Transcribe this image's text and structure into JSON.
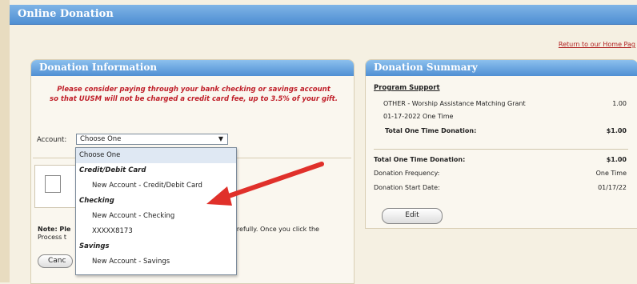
{
  "header": {
    "title": "Online Donation"
  },
  "home_link": "Return to our Home Pag",
  "donation_info": {
    "title": "Donation Information",
    "notice_line1": "Please consider paying through your bank checking or savings account",
    "notice_line2": "so that UUSM will not be charged a credit card fee, up to 3.5% of your gift.",
    "account_label": "Account:",
    "account_selected": "Choose One",
    "dropdown_options": [
      {
        "label": "Choose One",
        "type": "option",
        "selected": true
      },
      {
        "label": "Credit/Debit Card",
        "type": "group"
      },
      {
        "label": "New Account - Credit/Debit Card",
        "type": "option"
      },
      {
        "label": "Checking",
        "type": "group"
      },
      {
        "label": "New Account - Checking",
        "type": "option"
      },
      {
        "label": "XXXXX8173",
        "type": "option"
      },
      {
        "label": "Savings",
        "type": "group"
      },
      {
        "label": "New Account - Savings",
        "type": "option"
      }
    ],
    "note_left": "Note: Ple",
    "note_left2": "Process t",
    "note_right": "arefully. Once you click the",
    "cancel_label": "Canc"
  },
  "summary": {
    "title": "Donation Summary",
    "section_heading": "Program Support",
    "item_name": "OTHER - Worship Assistance Matching Grant",
    "item_amount": "1.00",
    "item_date": "01-17-2022 One Time",
    "subtotal_label": "Total One Time Donation:",
    "subtotal_value": "$1.00",
    "total_label": "Total One Time Donation:",
    "total_value": "$1.00",
    "frequency_label": "Donation Frequency:",
    "frequency_value": "One Time",
    "start_label": "Donation Start Date:",
    "start_value": "01/17/22",
    "edit_label": "Edit"
  },
  "colors": {
    "header_blue": "#4f8fd3",
    "notice_red": "#c0202a",
    "arrow_red": "#e0302a"
  }
}
